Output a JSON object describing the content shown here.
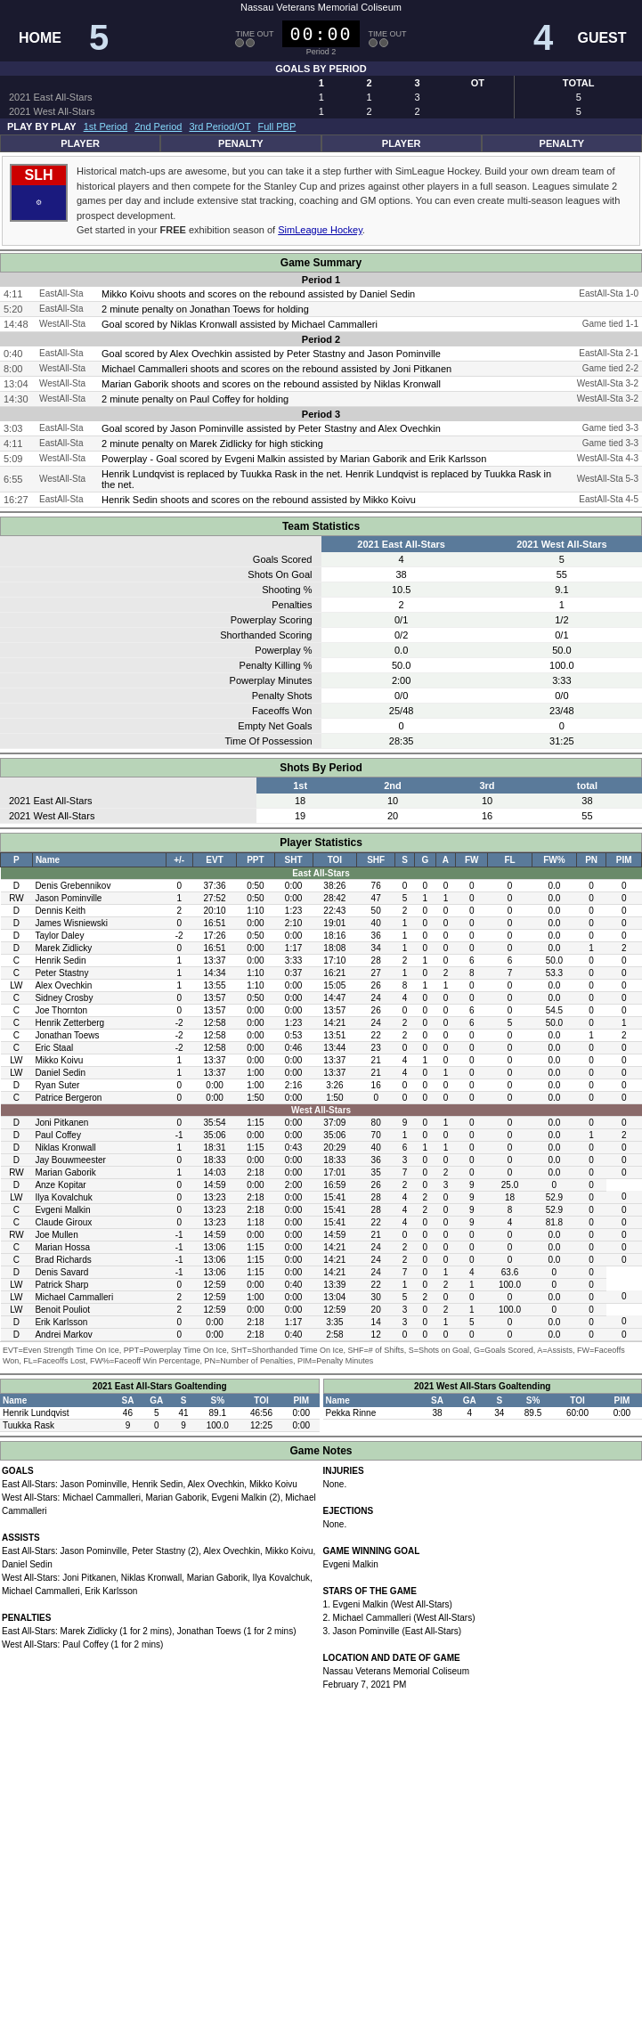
{
  "header": {
    "venue": "Nassau Veterans Memorial Coliseum",
    "home_label": "HOME",
    "guest_label": "GUEST",
    "home_score": "5",
    "guest_score": "4",
    "home_timeout_label": "TIME OUT",
    "guest_timeout_label": "TIME OUT",
    "clock": "00:00",
    "period": "Period 2"
  },
  "teams": {
    "home": "2021 East All-Stars",
    "guest": "2021 West All-Stars"
  },
  "goals_by_period": {
    "headers": [
      "",
      "1",
      "2",
      "3",
      "OT",
      "TOTAL"
    ],
    "rows": [
      [
        "2021 East All-Stars",
        "1",
        "1",
        "3",
        "",
        "5"
      ],
      [
        "2021 West All-Stars",
        "1",
        "2",
        "2",
        "",
        "5"
      ]
    ]
  },
  "pbp_nav": {
    "label": "PLAY BY PLAY",
    "links": [
      "1st Period",
      "2nd Period",
      "3rd Period/OT",
      "Full PBP"
    ]
  },
  "pp_headers": [
    "PLAYER",
    "PENALTY",
    "PLAYER",
    "PENALTY"
  ],
  "slh": {
    "logo": "SLH",
    "text": "Historical match-ups are awesome, but you can take it a step further with SimLeague Hockey. Build your own dream team of historical players and then compete for the Stanley Cup and prizes against other players in a full season. Leagues simulate 2 games per day and include extensive stat tracking, coaching and GM options. You can even create multi-season leagues with prospect development.",
    "cta": "Get started in your FREE exhibition season of SimLeague Hockey."
  },
  "game_summary": {
    "title": "Game Summary",
    "periods": [
      {
        "label": "Period 1",
        "events": [
          {
            "time": "4:11",
            "team": "EastAll-Sta",
            "event": "Mikko Koivu shoots and scores on the rebound assisted by Daniel Sedin",
            "score": "EastAll-Sta 1-0"
          },
          {
            "time": "5:20",
            "team": "EastAll-Sta",
            "event": "2 minute penalty on Jonathan Toews for holding",
            "score": ""
          },
          {
            "time": "14:48",
            "team": "WestAll-Sta",
            "event": "Goal scored by Niklas Kronwall assisted by Michael Cammalleri",
            "score": "Game tied 1-1"
          }
        ]
      },
      {
        "label": "Period 2",
        "events": [
          {
            "time": "0:40",
            "team": "EastAll-Sta",
            "event": "Goal scored by Alex Ovechkin assisted by Peter Stastny and Jason Pominville",
            "score": "EastAll-Sta 2-1"
          },
          {
            "time": "8:00",
            "team": "WestAll-Sta",
            "event": "Michael Cammalleri shoots and scores on the rebound assisted by Joni Pitkanen",
            "score": "Game tied 2-2"
          },
          {
            "time": "13:04",
            "team": "WestAll-Sta",
            "event": "Marian Gaborik shoots and scores on the rebound assisted by Niklas Kronwall",
            "score": "WestAll-Sta 3-2"
          },
          {
            "time": "14:30",
            "team": "WestAll-Sta",
            "event": "2 minute penalty on Paul Coffey for holding",
            "score": "WestAll-Sta 3-2"
          }
        ]
      },
      {
        "label": "Period 3",
        "events": [
          {
            "time": "3:03",
            "team": "EastAll-Sta",
            "event": "Goal scored by Jason Pominville assisted by Peter Stastny and Alex Ovechkin",
            "score": "Game tied 3-3"
          },
          {
            "time": "4:11",
            "team": "EastAll-Sta",
            "event": "2 minute penalty on Marek Zidlicky for high sticking",
            "score": "Game tied 3-3"
          },
          {
            "time": "5:09",
            "team": "WestAll-Sta",
            "event": "Powerplay - Goal scored by Evgeni Malkin assisted by Marian Gaborik and Erik Karlsson",
            "score": "WestAll-Sta 4-3"
          },
          {
            "time": "6:55",
            "team": "WestAll-Sta",
            "event": "Henrik Lundqvist is replaced by Tuukka Rask in the net. Henrik Lundqvist is replaced by Tuukka Rask in the net.",
            "score": "WestAll-Sta 5-3"
          },
          {
            "time": "16:27",
            "team": "EastAll-Sta",
            "event": "Henrik Sedin shoots and scores on the rebound assisted by Mikko Koivu",
            "score": "EastAll-Sta 4-5"
          }
        ]
      }
    ]
  },
  "team_stats": {
    "title": "Team Statistics",
    "col_home": "2021 East All-Stars",
    "col_guest": "2021 West All-Stars",
    "rows": [
      [
        "Goals Scored",
        "4",
        "5"
      ],
      [
        "Shots On Goal",
        "38",
        "55"
      ],
      [
        "Shooting %",
        "10.5",
        "9.1"
      ],
      [
        "Penalties",
        "2",
        "1"
      ],
      [
        "Powerplay Scoring",
        "0/1",
        "1/2"
      ],
      [
        "Shorthanded Scoring",
        "0/2",
        "0/1"
      ],
      [
        "Powerplay %",
        "0.0",
        "50.0"
      ],
      [
        "Penalty Killing %",
        "50.0",
        "100.0"
      ],
      [
        "Powerplay Minutes",
        "2:00",
        "3:33"
      ],
      [
        "Penalty Shots",
        "0/0",
        "0/0"
      ],
      [
        "Faceoffs Won",
        "25/48",
        "23/48"
      ],
      [
        "Empty Net Goals",
        "0",
        "0"
      ],
      [
        "Time Of Possession",
        "28:35",
        "31:25"
      ]
    ]
  },
  "shots_by_period": {
    "title": "Shots By Period",
    "headers": [
      "",
      "1st",
      "2nd",
      "3rd",
      "total"
    ],
    "rows": [
      [
        "2021 East All-Stars",
        "18",
        "10",
        "10",
        "38"
      ],
      [
        "2021 West All-Stars",
        "19",
        "20",
        "16",
        "55"
      ]
    ]
  },
  "player_stats": {
    "title": "Player Statistics",
    "headers": [
      "P",
      "Name",
      "+/-",
      "EVT",
      "PPT",
      "SHT",
      "TOI",
      "SHF",
      "S",
      "G",
      "A",
      "FW",
      "FL",
      "FW%",
      "PN",
      "PIM"
    ],
    "east_team": "East All-Stars",
    "east_players": [
      [
        "D",
        "Denis Grebennikov",
        "0",
        "37:36",
        "0:50",
        "0:00",
        "38:26",
        "76",
        "0",
        "0",
        "0",
        "0",
        "0",
        "0.0",
        "0",
        "0"
      ],
      [
        "RW",
        "Jason Pominville",
        "1",
        "27:52",
        "0:50",
        "0:00",
        "28:42",
        "47",
        "5",
        "1",
        "1",
        "0",
        "0",
        "0.0",
        "0",
        "0"
      ],
      [
        "D",
        "Dennis Keith",
        "2",
        "20:10",
        "1:10",
        "1:23",
        "22:43",
        "50",
        "2",
        "0",
        "0",
        "0",
        "0",
        "0.0",
        "0",
        "0"
      ],
      [
        "D",
        "James Wisniewski",
        "0",
        "16:51",
        "0:00",
        "2:10",
        "19:01",
        "40",
        "1",
        "0",
        "0",
        "0",
        "0",
        "0.0",
        "0",
        "0"
      ],
      [
        "D",
        "Taylor Daley",
        "-2",
        "17:26",
        "0:50",
        "0:00",
        "18:16",
        "36",
        "1",
        "0",
        "0",
        "0",
        "0",
        "0.0",
        "0",
        "0"
      ],
      [
        "D",
        "Marek Zidlicky",
        "0",
        "16:51",
        "0:00",
        "1:17",
        "18:08",
        "34",
        "1",
        "0",
        "0",
        "0",
        "0",
        "0.0",
        "1",
        "2"
      ],
      [
        "C",
        "Henrik Sedin",
        "1",
        "13:37",
        "0:00",
        "3:33",
        "17:10",
        "28",
        "2",
        "1",
        "0",
        "6",
        "6",
        "50.0",
        "0",
        "0"
      ],
      [
        "C",
        "Peter Stastny",
        "1",
        "14:34",
        "1:10",
        "0:37",
        "16:21",
        "27",
        "1",
        "0",
        "2",
        "8",
        "7",
        "53.3",
        "0",
        "0"
      ],
      [
        "LW",
        "Alex Ovechkin",
        "1",
        "13:55",
        "1:10",
        "0:00",
        "15:05",
        "26",
        "8",
        "1",
        "1",
        "0",
        "0",
        "0.0",
        "0",
        "0"
      ],
      [
        "C",
        "Sidney Crosby",
        "0",
        "13:57",
        "0:50",
        "0:00",
        "14:47",
        "24",
        "4",
        "0",
        "0",
        "0",
        "0",
        "0.0",
        "0",
        "0"
      ],
      [
        "C",
        "Joe Thornton",
        "0",
        "13:57",
        "0:00",
        "0:00",
        "13:57",
        "26",
        "0",
        "0",
        "0",
        "6",
        "0",
        "6",
        "54.5",
        "0",
        "0"
      ],
      [
        "C",
        "Henrik Zetterberg",
        "-2",
        "12:58",
        "0:00",
        "1:23",
        "14:21",
        "24",
        "2",
        "0",
        "0",
        "6",
        "5",
        "50.0",
        "0",
        "1"
      ],
      [
        "C",
        "Jonathan Toews",
        "-2",
        "12:58",
        "0:00",
        "0:53",
        "13:51",
        "22",
        "2",
        "0",
        "0",
        "0",
        "0",
        "0.0",
        "1",
        "2"
      ],
      [
        "C",
        "Eric Staal",
        "-2",
        "12:58",
        "0:00",
        "0:46",
        "13:44",
        "23",
        "0",
        "0",
        "0",
        "0",
        "0",
        "0.0",
        "0",
        "0"
      ],
      [
        "LW",
        "Mikko Koivu",
        "1",
        "13:37",
        "0:00",
        "0:00",
        "13:37",
        "21",
        "4",
        "1",
        "0",
        "0",
        "0",
        "0.0",
        "0",
        "0"
      ],
      [
        "LW",
        "Daniel Sedin",
        "1",
        "13:37",
        "1:00",
        "0:00",
        "13:37",
        "21",
        "4",
        "0",
        "1",
        "0",
        "0",
        "0.0",
        "0",
        "0"
      ],
      [
        "D",
        "Ryan Suter",
        "0",
        "0:00",
        "1:00",
        "2:16",
        "3:26",
        "16",
        "0",
        "0",
        "0",
        "0",
        "0",
        "0.0",
        "0",
        "0"
      ],
      [
        "C",
        "Patrice Bergeron",
        "0",
        "0:00",
        "1:50",
        "0:00",
        "1:50",
        "0",
        "0",
        "0",
        "0",
        "0",
        "0",
        "0.0",
        "0",
        "0"
      ]
    ],
    "west_team": "West All-Stars",
    "west_players": [
      [
        "D",
        "Joni Pitkanen",
        "0",
        "35:54",
        "1:15",
        "0:00",
        "37:09",
        "80",
        "9",
        "0",
        "1",
        "0",
        "0",
        "0.0",
        "0",
        "0"
      ],
      [
        "D",
        "Paul Coffey",
        "-1",
        "35:06",
        "0:00",
        "0:00",
        "35:06",
        "70",
        "1",
        "0",
        "0",
        "0",
        "0",
        "0.0",
        "1",
        "2"
      ],
      [
        "D",
        "Niklas Kronwall",
        "1",
        "18:31",
        "1:15",
        "0:43",
        "20:29",
        "40",
        "6",
        "1",
        "1",
        "0",
        "0",
        "0.0",
        "0",
        "0"
      ],
      [
        "D",
        "Jay Bouwmeester",
        "0",
        "18:33",
        "0:00",
        "0:00",
        "18:33",
        "36",
        "3",
        "0",
        "0",
        "0",
        "0",
        "0.0",
        "0",
        "0"
      ],
      [
        "RW",
        "Marian Gaborik",
        "1",
        "14:03",
        "2:18",
        "0:00",
        "17:01",
        "35",
        "7",
        "0",
        "2",
        "0",
        "0",
        "0.0",
        "0",
        "0"
      ],
      [
        "D",
        "Anze Kopitar",
        "0",
        "14:59",
        "0:00",
        "2:00",
        "16:59",
        "26",
        "2",
        "0",
        "3",
        "9",
        "25.0",
        "0",
        "0"
      ],
      [
        "LW",
        "Ilya Kovalchuk",
        "0",
        "13:23",
        "2:18",
        "0:00",
        "15:41",
        "28",
        "4",
        "2",
        "0",
        "9",
        "18",
        "52.9",
        "0",
        "0"
      ],
      [
        "C",
        "Evgeni Malkin",
        "0",
        "13:23",
        "2:18",
        "0:00",
        "15:41",
        "28",
        "4",
        "2",
        "0",
        "9",
        "8",
        "52.9",
        "0",
        "0"
      ],
      [
        "C",
        "Claude Giroux",
        "0",
        "13:23",
        "1:18",
        "0:00",
        "15:41",
        "22",
        "4",
        "0",
        "0",
        "9",
        "4",
        "81.8",
        "0",
        "0"
      ],
      [
        "RW",
        "Joe Mullen",
        "-1",
        "14:59",
        "0:00",
        "0:00",
        "14:59",
        "21",
        "0",
        "0",
        "0",
        "0",
        "0",
        "0.0",
        "0",
        "0"
      ],
      [
        "C",
        "Marian Hossa",
        "-1",
        "13:06",
        "1:15",
        "0:00",
        "14:21",
        "24",
        "2",
        "0",
        "0",
        "0",
        "0",
        "0.0",
        "0",
        "0"
      ],
      [
        "C",
        "Brad Richards",
        "-1",
        "13:06",
        "1:15",
        "0:00",
        "14:21",
        "24",
        "2",
        "0",
        "0",
        "0",
        "0",
        "0.0",
        "0",
        "0"
      ],
      [
        "D",
        "Denis Savard",
        "-1",
        "13:06",
        "1:15",
        "0:00",
        "14:21",
        "24",
        "7",
        "0",
        "1",
        "4",
        "63.6",
        "0",
        "0"
      ],
      [
        "LW",
        "Patrick Sharp",
        "0",
        "12:59",
        "0:00",
        "0:40",
        "13:39",
        "22",
        "1",
        "0",
        "2",
        "1",
        "100.0",
        "0",
        "0"
      ],
      [
        "LW",
        "Michael Cammalleri",
        "2",
        "12:59",
        "1:00",
        "0:00",
        "13:04",
        "30",
        "5",
        "2",
        "0",
        "0",
        "0.0",
        "0",
        "0"
      ],
      [
        "LW",
        "Benoit Pouliot",
        "2",
        "12:59",
        "0:00",
        "0:00",
        "12:59",
        "20",
        "3",
        "0",
        "2",
        "1",
        "100.0",
        "0",
        "0"
      ],
      [
        "D",
        "Erik Karlsson",
        "0",
        "0:00",
        "2:18",
        "1:17",
        "3:35",
        "14",
        "3",
        "0",
        "1",
        "5",
        "0",
        "0.0",
        "0",
        "0"
      ],
      [
        "D",
        "Andrei Markov",
        "0",
        "0:00",
        "2:18",
        "0:40",
        "2:58",
        "12",
        "0",
        "0",
        "0",
        "0",
        "0",
        "0.0",
        "0",
        "0"
      ]
    ]
  },
  "legend": "EVT=Even Strength Time On Ice, PPT=Powerplay Time On Ice, SHT=Shorthanded Time On Ice, SHF=# of Shifts, S=Shots on Goal, G=Goals Scored, A=Assists, FW=Faceoffs Won, FL=Faceoffs Lost, FW%=Faceoff Win Percentage, PN=Number of Penalties, PIM=Penalty Minutes",
  "goaltending": {
    "title_east": "2021 East All-Stars Goaltending",
    "title_west": "2021 West All-Stars Goaltending",
    "headers": [
      "Name",
      "SA",
      "GA",
      "S",
      "S%",
      "TOI",
      "PIM"
    ],
    "east_goalies": [
      [
        "Henrik Lundqvist",
        "46",
        "5",
        "41",
        "89.1",
        "46:56",
        "0:00"
      ],
      [
        "Tuukka Rask",
        "9",
        "0",
        "9",
        "100.0",
        "12:25",
        "0:00"
      ]
    ],
    "west_goalies": [
      [
        "Pekka Rinne",
        "38",
        "4",
        "34",
        "89.5",
        "60:00",
        "0:00"
      ]
    ]
  },
  "game_notes": {
    "title": "Game Notes",
    "goals_title": "GOALS",
    "goals": "East All-Stars: Jason Pominville, Henrik Sedin, Alex Ovechkin, Mikko Koivu\nWest All-Stars: Michael Cammalleri, Marian Gaborik, Evgeni Malkin (2), Michael Cammalleri",
    "assists_title": "ASSISTS",
    "assists": "East All-Stars: Jason Pominville, Peter Stastny (2), Alex Ovechkin, Mikko Koivu, Daniel Sedin\nWest All-Stars: Joni Pitkanen, Niklas Kronwall, Marian Gaborik, Ilya Kovalchuk, Michael Cammalleri, Erik Karlsson",
    "penalties_title": "PENALTIES",
    "penalties": "East All-Stars: Marek Zidlicky (1 for 2 mins), Jonathan Toews (1 for 2 mins)\nWest All-Stars: Paul Coffey (1 for 2 mins)",
    "injuries_title": "INJURIES",
    "injuries": "None.",
    "ejections_title": "EJECTIONS",
    "ejections": "None.",
    "gwg_title": "GAME WINNING GOAL",
    "gwg": "Evgeni Malkin",
    "stars_title": "STARS OF THE GAME",
    "stars": "1. Evgeni Malkin (West All-Stars)\n2. Michael Cammalleri (West All-Stars)\n3. Jason Pominville (East All-Stars)",
    "location_title": "LOCATION AND DATE OF GAME",
    "location": "Nassau Veterans Memorial Coliseum\nFebruary 7, 2021 PM"
  }
}
